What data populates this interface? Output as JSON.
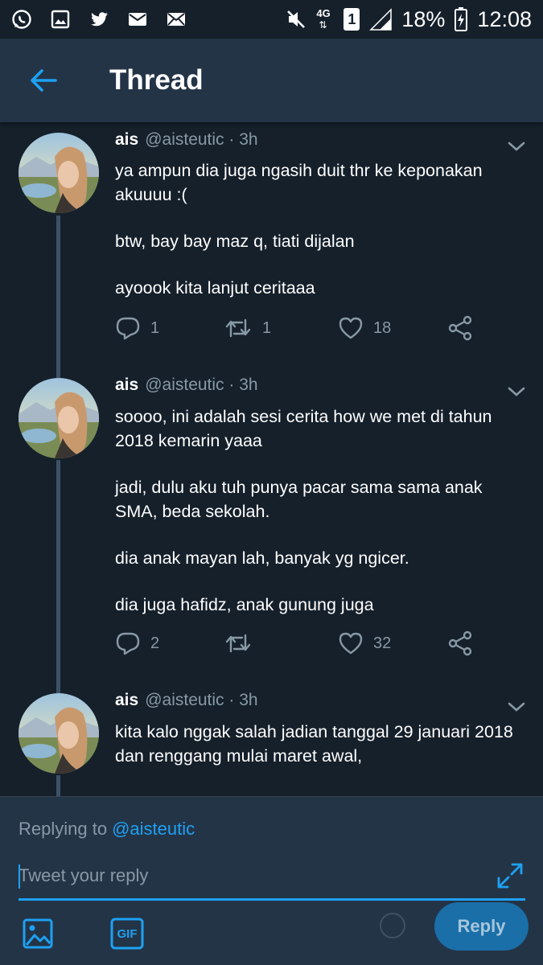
{
  "status_bar": {
    "left_icons": [
      "whatsapp-icon",
      "gallery-icon",
      "twitter-icon",
      "email-icon",
      "message-icon"
    ],
    "network": "4G",
    "sim": "1",
    "battery": "18%",
    "time": "12:08"
  },
  "header": {
    "title": "Thread",
    "back_icon": "back-arrow-icon"
  },
  "tweets": [
    {
      "name": "ais",
      "handle": "@aisteutic",
      "time": "· 3h",
      "paragraphs": [
        "ya ampun dia juga ngasih duit thr ke keponakan akuuuu :(",
        "btw, bay bay maz q, tiati dijalan",
        "ayoook kita lanjut ceritaaa"
      ],
      "replies": "1",
      "retweets": "1",
      "likes": "18"
    },
    {
      "name": "ais",
      "handle": "@aisteutic",
      "time": "· 3h",
      "paragraphs": [
        "soooo, ini adalah sesi cerita how we met di tahun 2018 kemarin yaaa",
        "jadi, dulu aku tuh punya pacar sama sama anak SMA, beda sekolah.",
        "dia anak mayan lah, banyak yg ngicer.",
        "dia juga hafidz, anak gunung juga"
      ],
      "replies": "2",
      "retweets": "",
      "likes": "32"
    },
    {
      "name": "ais",
      "handle": "@aisteutic",
      "time": "· 3h",
      "paragraphs": [
        "kita kalo nggak salah jadian tanggal 29 januari 2018 dan renggang mulai maret awal,"
      ],
      "replies": "",
      "retweets": "",
      "likes": ""
    }
  ],
  "composer": {
    "replying_label": "Replying to",
    "replying_handle": "@aisteutic",
    "placeholder": "Tweet your reply",
    "gif_label": "GIF",
    "reply_button": "Reply"
  },
  "colors": {
    "background": "#15202b",
    "bar": "#243447",
    "accent": "#1da1f2",
    "muted": "#8899a6"
  }
}
